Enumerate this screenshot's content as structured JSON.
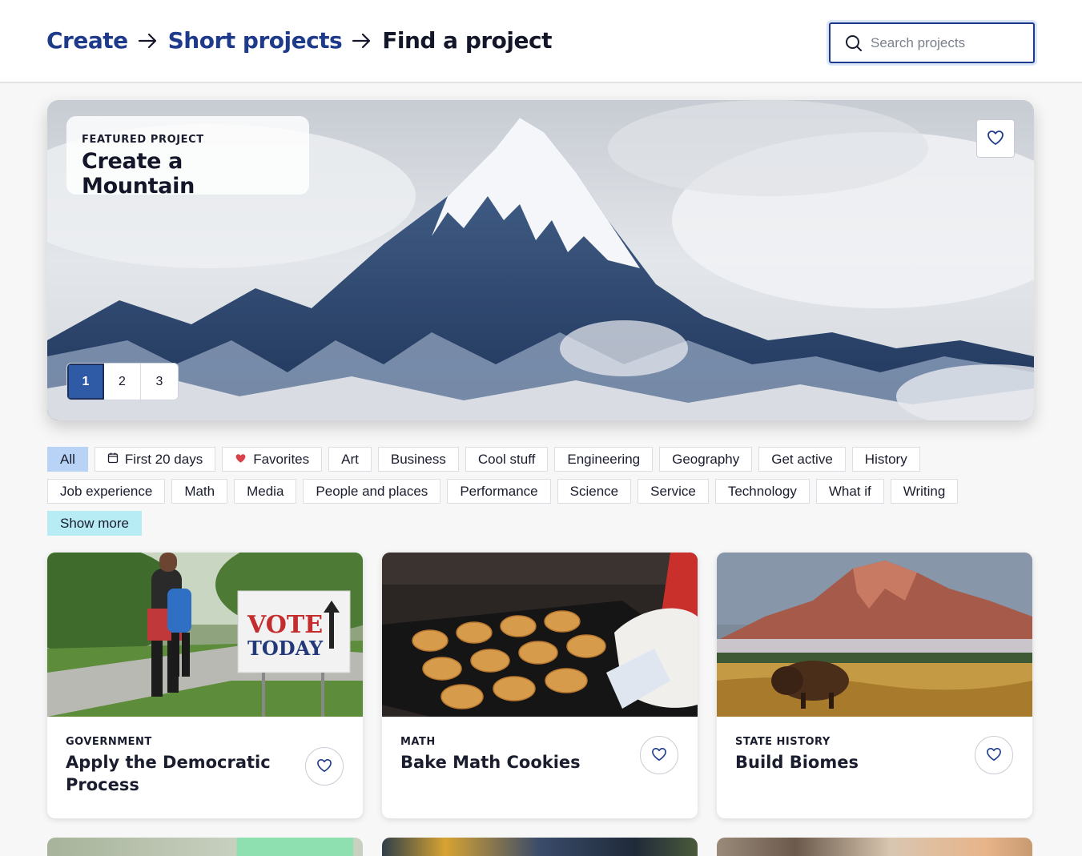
{
  "breadcrumb": {
    "items": [
      "Create",
      "Short projects"
    ],
    "current": "Find a project"
  },
  "search": {
    "placeholder": "Search projects",
    "value": ""
  },
  "featured": {
    "eyebrow": "FEATURED PROJECT",
    "title": "Create a Mountain",
    "pages": [
      "1",
      "2",
      "3"
    ],
    "active_page": "1"
  },
  "filters": {
    "row1": [
      "All",
      "First 20 days",
      "Favorites",
      "Art",
      "Business",
      "Cool stuff",
      "Engineering",
      "Geography",
      "Get active",
      "History"
    ],
    "row2": [
      "Job experience",
      "Math",
      "Media",
      "People and places",
      "Performance",
      "Science",
      "Service",
      "Technology",
      "What if",
      "Writing"
    ],
    "show_more": "Show more",
    "selected": "All"
  },
  "cards": [
    {
      "category": "GOVERNMENT",
      "title": "Apply the Democratic Process",
      "image_text_1": "VOTE",
      "image_text_2": "TODAY"
    },
    {
      "category": "MATH",
      "title": "Bake Math Cookies"
    },
    {
      "category": "STATE HISTORY",
      "title": "Build Biomes"
    }
  ],
  "colors": {
    "brand_blue": "#1e3a8a",
    "chip_selected": "#b9d3f7",
    "show_more": "#b8ecf5",
    "pager_active": "#2f5aa6",
    "heart_filled": "#d9414b"
  },
  "icons": [
    "arrow-right-icon",
    "search-icon",
    "heart-outline-icon",
    "calendar-icon",
    "heart-filled-icon"
  ]
}
